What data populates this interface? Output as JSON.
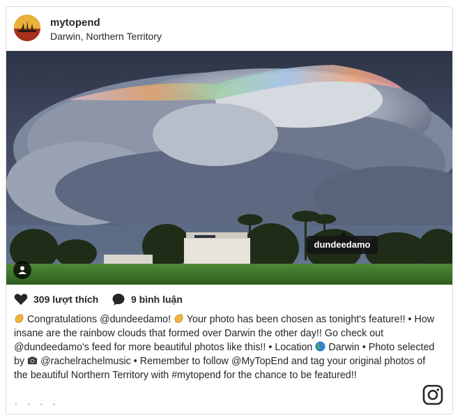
{
  "post": {
    "username": "mytopend",
    "location": "Darwin, Northern Territory",
    "tagged_user": "dundeedamo",
    "likes": "309 lượt thích",
    "comments": "9 bình luận"
  },
  "caption": {
    "part1": "Congratulations @dundeedamo!",
    "part2": "Your photo has been chosen as tonight's feature!! • How insane are the rainbow clouds that formed over Darwin the other day!! Go check out @dundeedamo's feed for more beautiful photos like this!! • Location",
    "part3": "Darwin • Photo selected by",
    "part4": "@rachelrachelmusic • Remember to follow @MyTopEnd and tag your original photos of the beautiful Northern Territory with #mytopend for the chance to be featured!!"
  },
  "icons": {
    "heart": "heart-icon",
    "comment": "comment-icon",
    "user_tag": "user-tag-icon",
    "instagram": "instagram-logo-icon",
    "clap": "clapping-hands-icon",
    "globe": "globe-icon",
    "camera": "camera-icon"
  },
  "colors": {
    "border": "#dbdbdb",
    "text": "#262626",
    "tag_bg": "#141414"
  }
}
